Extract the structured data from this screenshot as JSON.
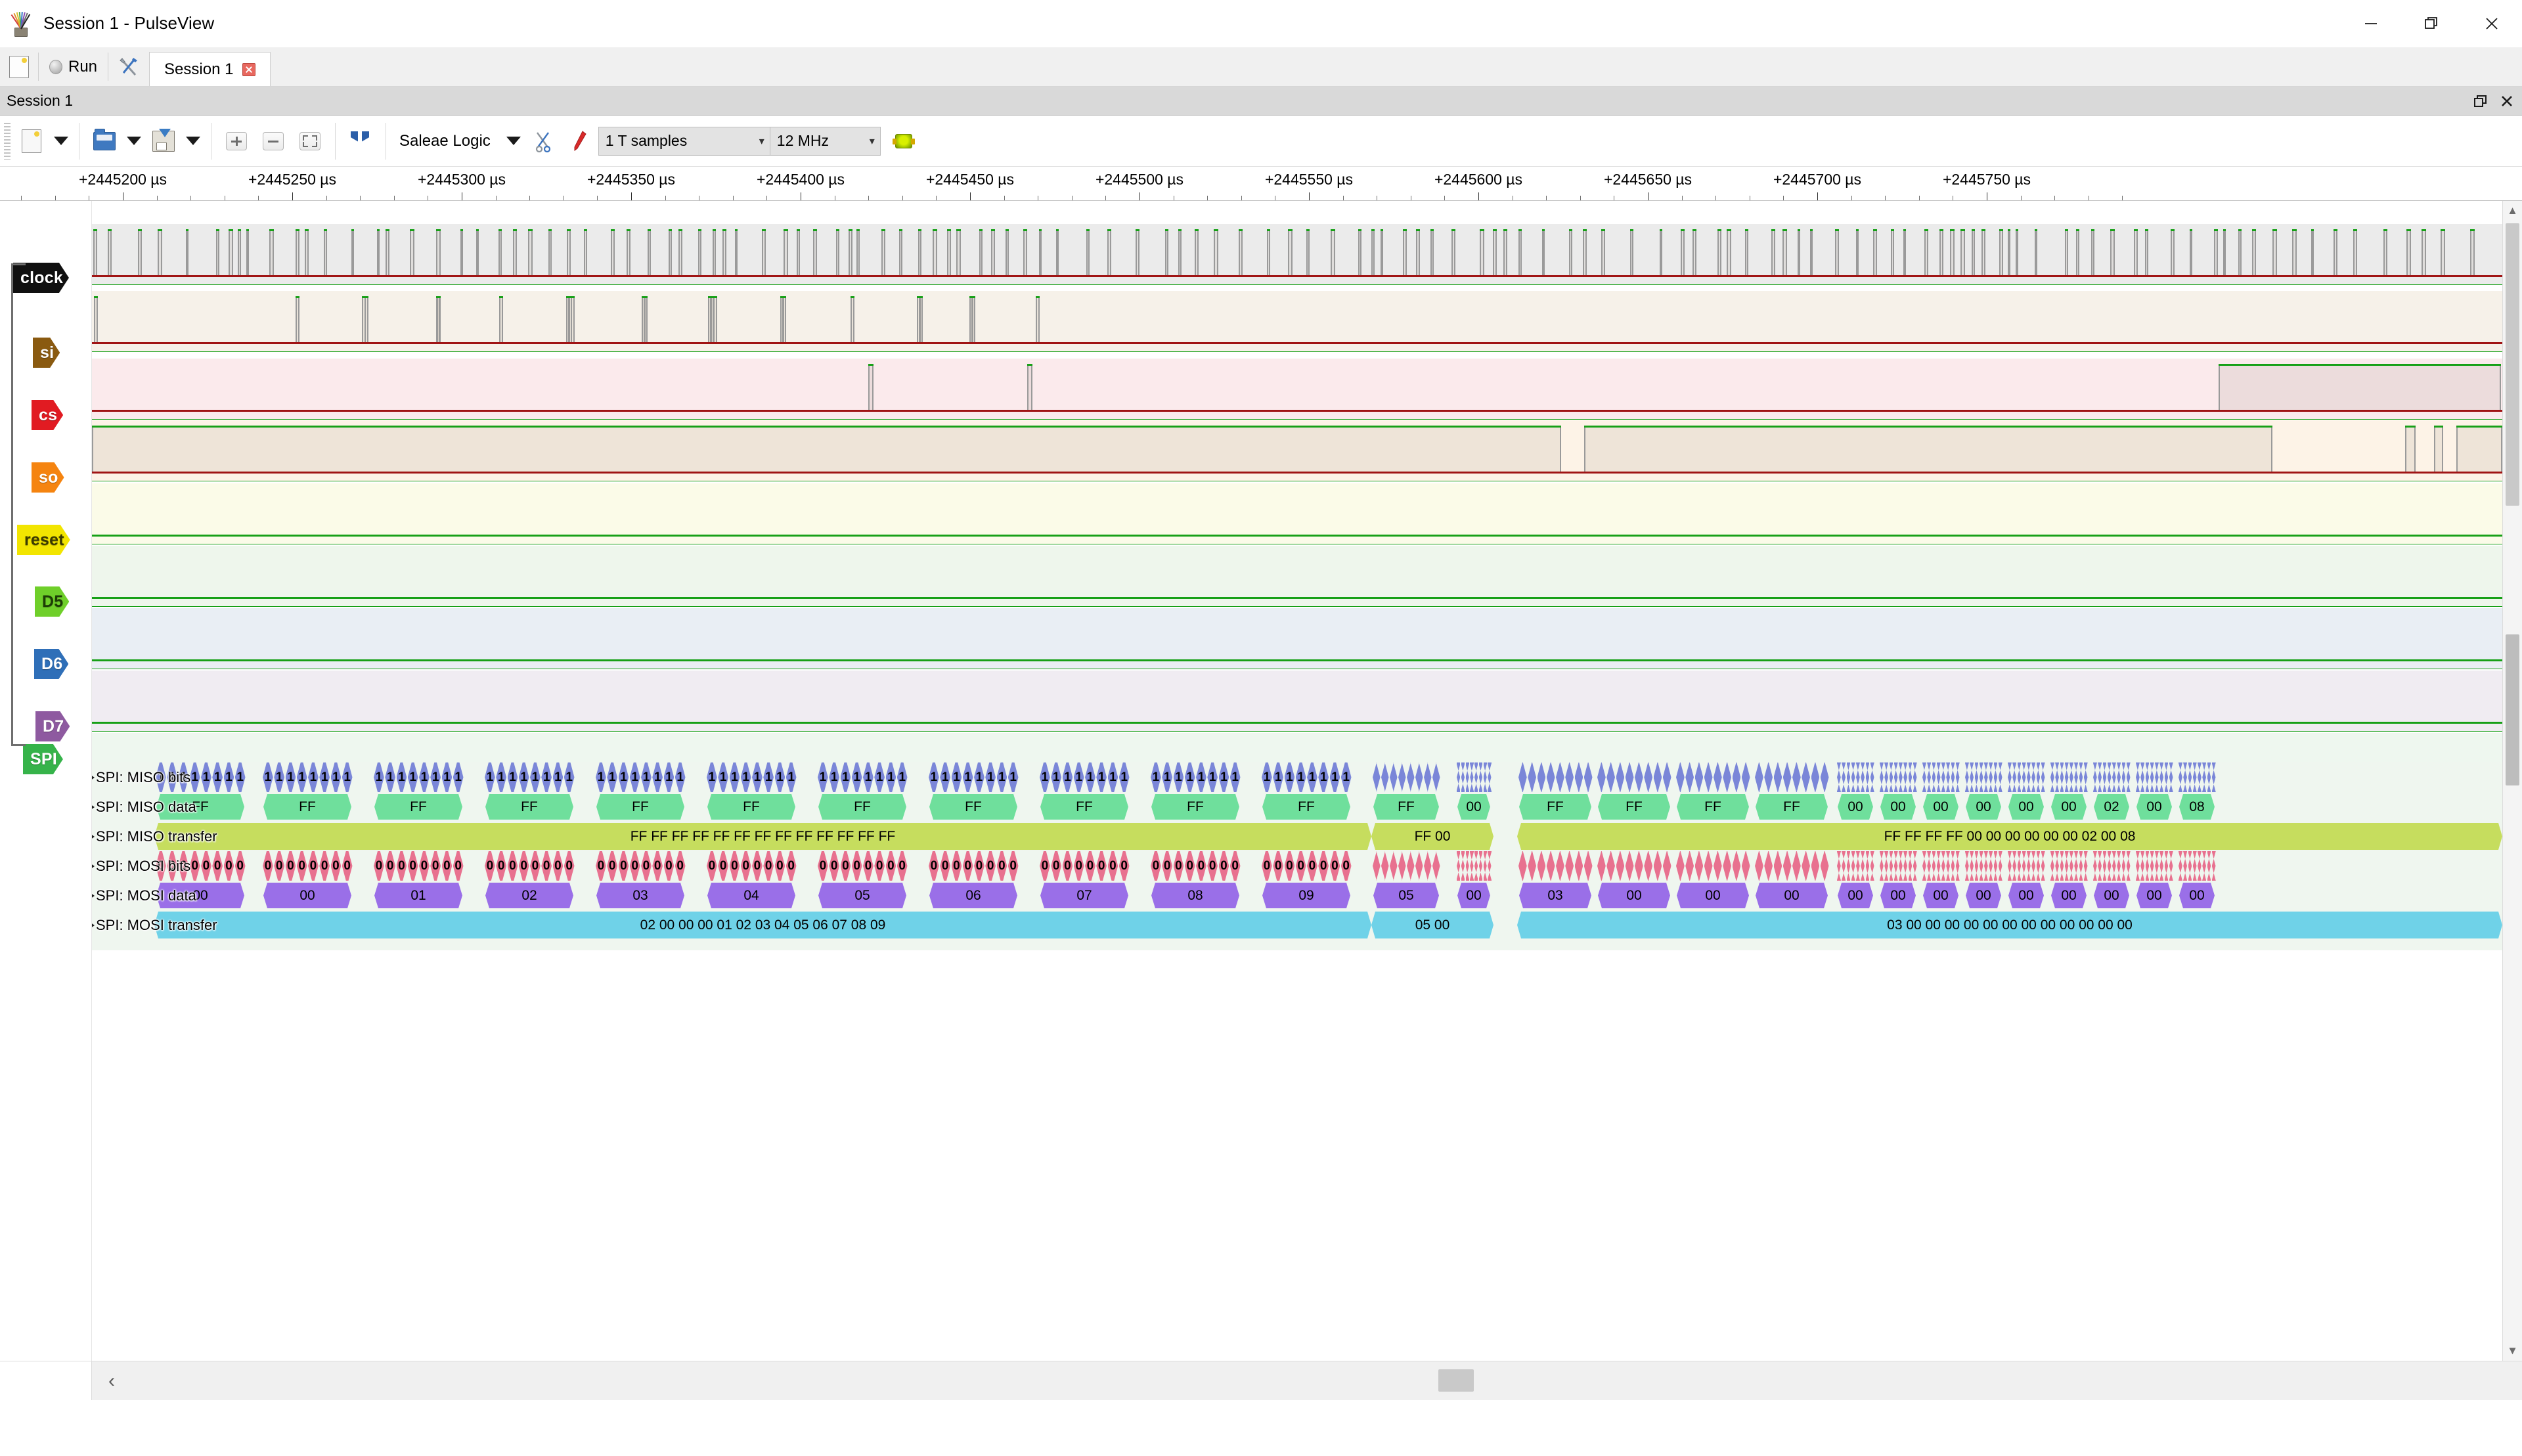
{
  "window": {
    "title": "Session 1 - PulseView",
    "app_icon": "pulseview-logo-icon",
    "minimize": "minimize-icon",
    "maximize": "restore-icon",
    "close": "close-icon"
  },
  "toolbar_top": {
    "new_session_icon": "new-session-icon",
    "run_label": "Run",
    "run_icon": "run-indicator-icon",
    "settings_icon": "wrench-screwdriver-icon",
    "tabs": [
      {
        "label": "Session 1",
        "close_icon": "tab-close-icon",
        "active": true
      }
    ]
  },
  "dock": {
    "title": "Session 1",
    "float_icon": "float-window-icon",
    "close_icon": "dock-close-icon"
  },
  "toolbar_main": {
    "new_icon": "new-document-icon",
    "new_dropdown_icon": "chevron-down-icon",
    "open_icon": "open-folder-icon",
    "open_dropdown_icon": "chevron-down-icon",
    "save_icon": "save-as-icon",
    "save_dropdown_icon": "chevron-down-icon",
    "zoom_in_icon": "zoom-in-icon",
    "zoom_out_icon": "zoom-out-icon",
    "zoom_fit_icon": "zoom-fit-icon",
    "cursors_icon": "show-cursors-icon",
    "device": "Saleae Logic",
    "device_dropdown_icon": "chevron-down-icon",
    "device_config_icon": "scissors-icon",
    "probe_icon": "probe-pen-icon",
    "sample_count": "1 T samples",
    "sample_count_caret": "chevron-down-icon",
    "sample_rate": "12 MHz",
    "sample_rate_caret": "chevron-down-icon",
    "status_led_icon": "capture-led-icon"
  },
  "ruler": {
    "unit": "µs",
    "labels": [
      "+2445200 µs",
      "+2445250 µs",
      "+2445300 µs",
      "+2445350 µs",
      "+2445400 µs",
      "+2445450 µs",
      "+2445500 µs",
      "+2445550 µs",
      "+2445600 µs",
      "+2445650 µs",
      "+2445700 µs",
      "+2445750 µs"
    ]
  },
  "channels": [
    {
      "name": "clock",
      "color": "#101010",
      "text": "#ffffff",
      "bg": "#ebebeb"
    },
    {
      "name": "si",
      "color": "#8a5a10",
      "text": "#ffffff",
      "bg": "#f6f1e9"
    },
    {
      "name": "cs",
      "color": "#e11b22",
      "text": "#ffffff",
      "bg": "#fbeaec"
    },
    {
      "name": "so",
      "color": "#f58410",
      "text": "#ffffff",
      "bg": "#fdf3e7"
    },
    {
      "name": "reset",
      "color": "#f2e500",
      "text": "#3a3a00",
      "bg": "#fbfbe8"
    },
    {
      "name": "D5",
      "color": "#6fcf2a",
      "text": "#1d3d06",
      "bg": "#eef6ec"
    },
    {
      "name": "D6",
      "color": "#2f6fb8",
      "text": "#ffffff",
      "bg": "#e9eef4"
    },
    {
      "name": "D7",
      "color": "#8e5aa0",
      "text": "#ffffff",
      "bg": "#f0ecf2"
    },
    {
      "name": "SPI",
      "color": "#36b34a",
      "text": "#ffffff",
      "bg": "#eef7ef"
    }
  ],
  "decoder": {
    "name": "SPI",
    "rows": [
      {
        "label": "SPI: MISO bits",
        "color": "#7a86d8",
        "kind": "bits"
      },
      {
        "label": "SPI: MISO data",
        "color": "#6fdf9c",
        "kind": "data"
      },
      {
        "label": "SPI: MISO transfer",
        "color": "#c6dd5e",
        "kind": "transfer"
      },
      {
        "label": "SPI: MOSI bits",
        "color": "#e8718f",
        "kind": "bits"
      },
      {
        "label": "SPI: MOSI data",
        "color": "#9a6fe8",
        "kind": "data"
      },
      {
        "label": "SPI: MOSI transfer",
        "color": "#6fd2e8",
        "kind": "transfer"
      }
    ],
    "miso_data": [
      "FF",
      "FF",
      "FF",
      "FF",
      "FF",
      "FF",
      "FF",
      "FF",
      "FF",
      "FF",
      "FF",
      "FF",
      "00",
      "FF",
      "FF",
      "FF",
      "FF",
      "00",
      "00",
      "00",
      "00",
      "00",
      "00",
      "02",
      "00",
      "08"
    ],
    "mosi_data": [
      "00",
      "00",
      "01",
      "02",
      "03",
      "04",
      "05",
      "06",
      "07",
      "08",
      "09",
      "05",
      "00",
      "03",
      "00",
      "00",
      "00",
      "00",
      "00",
      "00",
      "00",
      "00",
      "00",
      "00",
      "00",
      "00"
    ],
    "miso_transfers": [
      "FF FF FF FF FF FF FF FF FF FF FF FF FF",
      "FF 00",
      "FF FF FF FF 00 00 00 00 00 00 02 00 08"
    ],
    "mosi_transfers": [
      "02 00 00 00 01 02 03 04 05 06 07 08 09",
      "05 00",
      "03 00 00 00 00 00 00 00 00 00 00 00 00"
    ],
    "miso_bit_value": "1",
    "mosi_bit_value": "0"
  },
  "scrollbars": {
    "h_left_icon": "chevron-left-icon",
    "v_up_icon": "chevron-up-icon",
    "v_down_icon": "chevron-down-icon"
  }
}
